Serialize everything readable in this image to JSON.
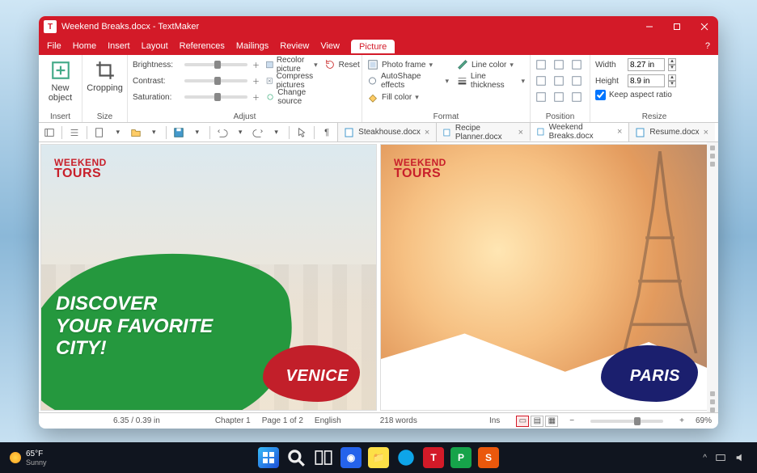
{
  "titlebar": {
    "title": "Weekend Breaks.docx - TextMaker",
    "appletter": "T"
  },
  "menus": {
    "file": "File",
    "home": "Home",
    "insert": "Insert",
    "layout": "Layout",
    "references": "References",
    "mailings": "Mailings",
    "review": "Review",
    "view": "View",
    "picture": "Picture"
  },
  "ribbon": {
    "insert": {
      "new_object": "New object",
      "label": "Insert"
    },
    "size": {
      "cropping": "Cropping",
      "label": "Size"
    },
    "adjust": {
      "brightness": "Brightness:",
      "contrast": "Contrast:",
      "saturation": "Saturation:",
      "recolor": "Recolor picture",
      "compress": "Compress pictures",
      "change_source": "Change source",
      "reset": "Reset",
      "label": "Adjust"
    },
    "format": {
      "photo_frame": "Photo frame",
      "autoshape": "AutoShape effects",
      "fill_color": "Fill color",
      "line_color": "Line color",
      "line_thickness": "Line thickness",
      "label": "Format"
    },
    "position": {
      "label": "Position"
    },
    "resize": {
      "width_label": "Width",
      "width_value": "8.27 in",
      "height_label": "Height",
      "height_value": "8.9 in",
      "keep_aspect": "Keep aspect ratio",
      "label": "Resize"
    }
  },
  "tabs": [
    {
      "name": "Steakhouse.docx"
    },
    {
      "name": "Recipe Planner.docx"
    },
    {
      "name": "Weekend Breaks.docx"
    },
    {
      "name": "Resume.docx"
    }
  ],
  "document": {
    "brand_l1": "WEEKEND",
    "brand_l2": "TOURS",
    "headline": "DISCOVER YOUR FAVORITE CITY!",
    "city1": "VENICE",
    "city2": "PARIS"
  },
  "status": {
    "pos": "6.35 / 0.39 in",
    "chapter": "Chapter 1",
    "page": "Page 1 of 2",
    "lang": "English",
    "words": "218 words",
    "ins": "Ins",
    "zoom": "69%"
  },
  "taskbar": {
    "temp": "65°F",
    "cond": "Sunny"
  }
}
